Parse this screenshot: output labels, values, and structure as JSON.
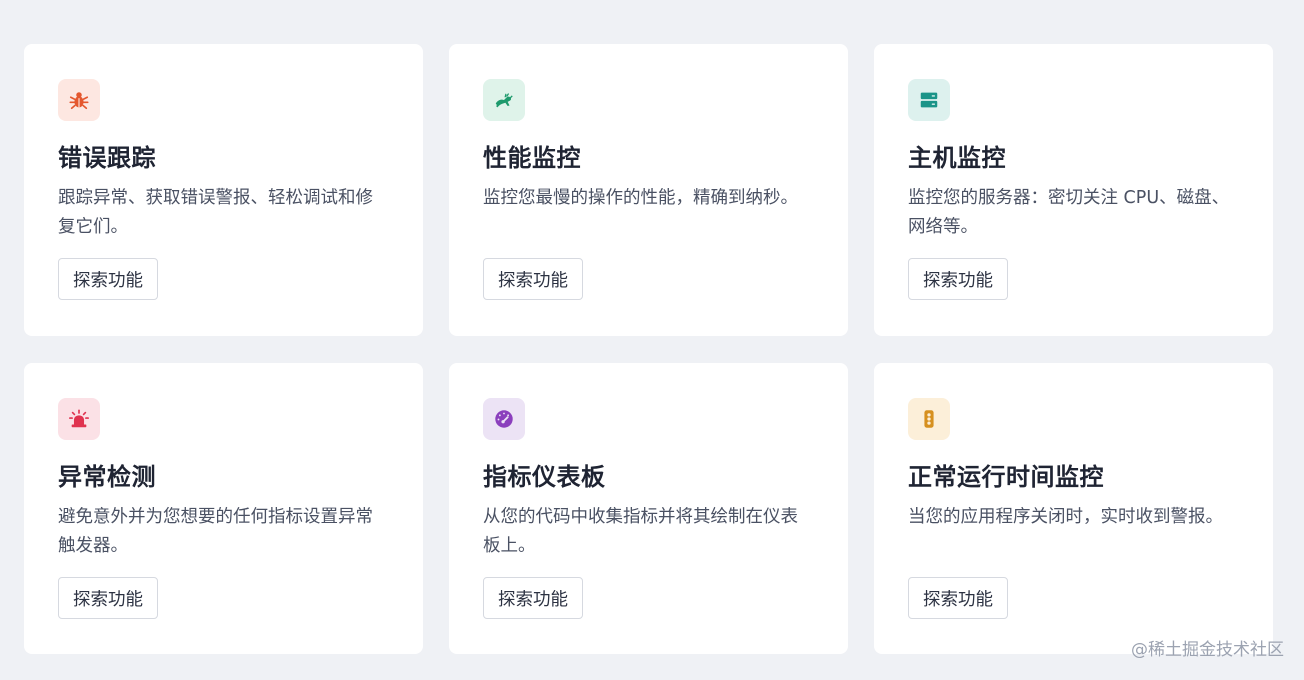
{
  "cards": [
    {
      "title": "错误跟踪",
      "description": "跟踪异常、获取错误警报、轻松调试和修复它们。",
      "button_label": "探索功能",
      "icon": "bug-icon",
      "icon_bg": "#fde7e1",
      "icon_color": "#e4572e"
    },
    {
      "title": "性能监控",
      "description": "监控您最慢的操作的性能，精确到纳秒。",
      "button_label": "探索功能",
      "icon": "rabbit-icon",
      "icon_bg": "#dff3ea",
      "icon_color": "#1e9a6d"
    },
    {
      "title": "主机监控",
      "description": "监控您的服务器：密切关注 CPU、磁盘、网络等。",
      "button_label": "探索功能",
      "icon": "server-icon",
      "icon_bg": "#ddf1ee",
      "icon_color": "#1a9488"
    },
    {
      "title": "异常检测",
      "description": "避免意外并为您想要的任何指标设置异常触发器。",
      "button_label": "探索功能",
      "icon": "siren-icon",
      "icon_bg": "#fbe1e6",
      "icon_color": "#e0334f"
    },
    {
      "title": "指标仪表板",
      "description": "从您的代码中收集指标并将其绘制在仪表板上。",
      "button_label": "探索功能",
      "icon": "gauge-icon",
      "icon_bg": "#ece3f5",
      "icon_color": "#8b3fbd"
    },
    {
      "title": "正常运行时间监控",
      "description": "当您的应用程序关闭时，实时收到警报。",
      "button_label": "探索功能",
      "icon": "traffic-light-icon",
      "icon_bg": "#fcefd9",
      "icon_color": "#d6901f"
    }
  ],
  "watermark": "@稀土掘金技术社区"
}
